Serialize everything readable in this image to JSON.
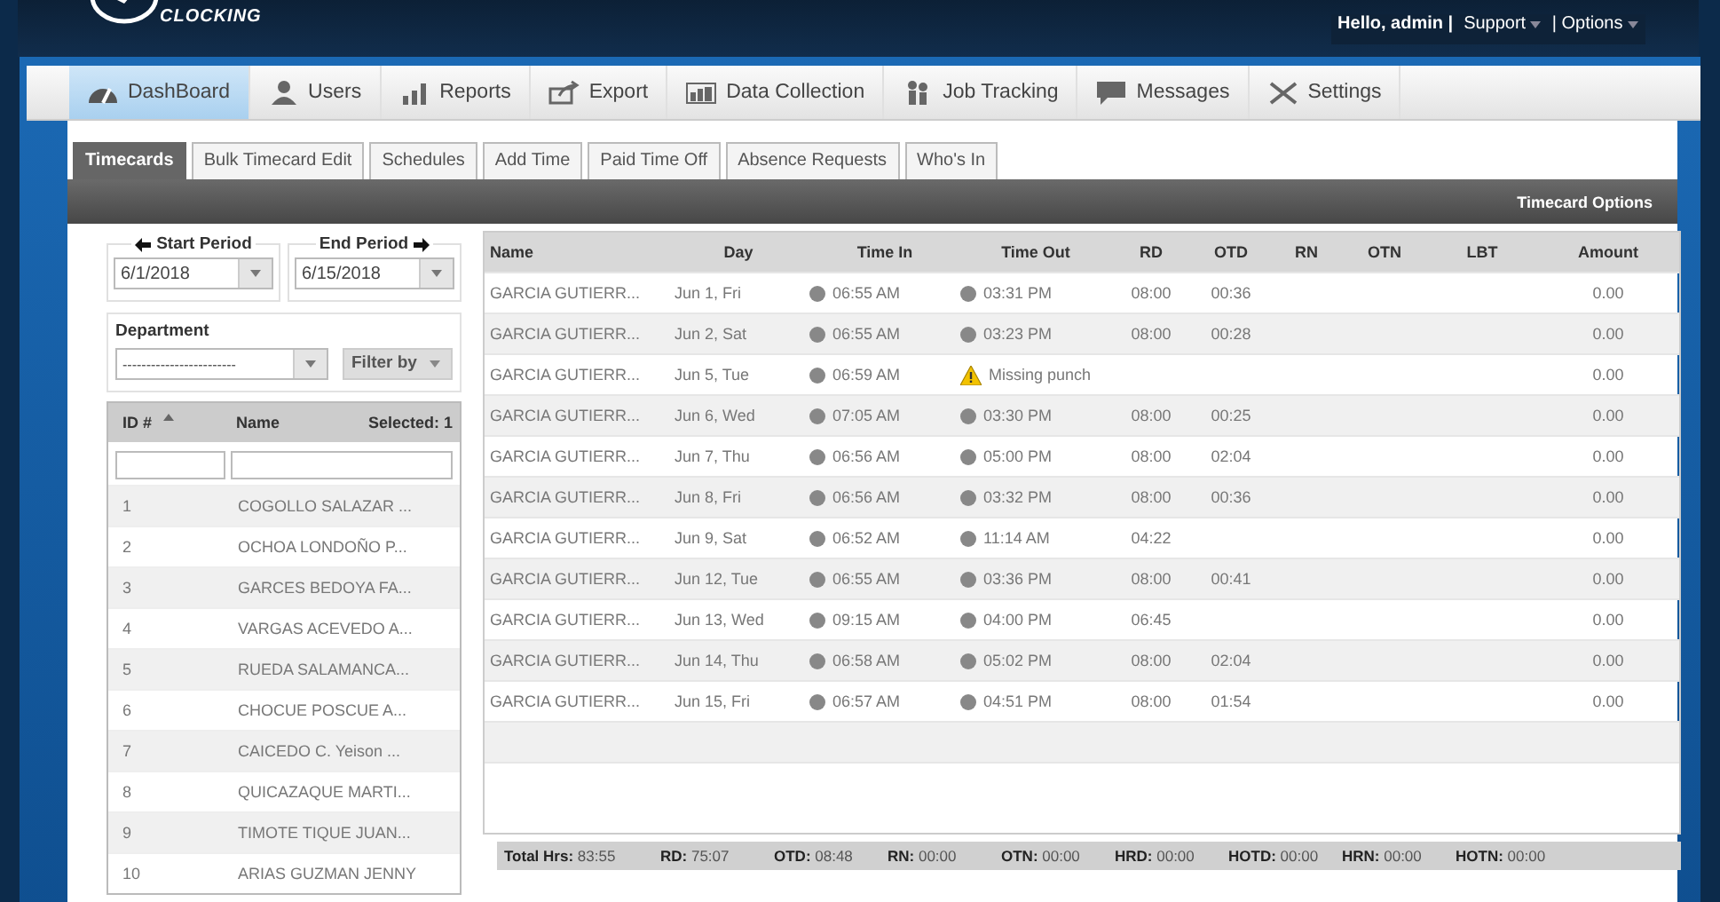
{
  "header": {
    "logo": "CLOCKING",
    "greeting": "Hello, admin |",
    "links": [
      {
        "label": "Support"
      },
      {
        "label": "| Options"
      }
    ]
  },
  "nav": [
    {
      "label": "DashBoard",
      "selected": true
    },
    {
      "label": "Users",
      "selected": false
    },
    {
      "label": "Reports",
      "selected": false
    },
    {
      "label": "Export",
      "selected": false
    },
    {
      "label": "Data Collection",
      "selected": false
    },
    {
      "label": "Job Tracking",
      "selected": false
    },
    {
      "label": "Messages",
      "selected": false
    },
    {
      "label": "Settings",
      "selected": false
    }
  ],
  "tabs": [
    {
      "label": "Timecards",
      "selected": true
    },
    {
      "label": "Bulk Timecard Edit",
      "selected": false
    },
    {
      "label": "Schedules",
      "selected": false
    },
    {
      "label": "Add Time",
      "selected": false
    },
    {
      "label": "Paid Time Off",
      "selected": false
    },
    {
      "label": "Absence Requests",
      "selected": false
    },
    {
      "label": "Who's In",
      "selected": false
    }
  ],
  "options_button": "Timecard Options",
  "period": {
    "start_label": "Start Period",
    "start_value": "6/1/2018",
    "end_label": "End Period",
    "end_value": "6/15/2018"
  },
  "department": {
    "label": "Department",
    "value": "------------------------",
    "filter": "Filter by"
  },
  "employees": {
    "columns": [
      "ID #",
      "Name",
      "Selected: 1"
    ],
    "rows": [
      {
        "id": "1",
        "name": "COGOLLO SALAZAR ..."
      },
      {
        "id": "2",
        "name": "OCHOA LONDOÑO P..."
      },
      {
        "id": "3",
        "name": "GARCES BEDOYA FA..."
      },
      {
        "id": "4",
        "name": "VARGAS ACEVEDO A..."
      },
      {
        "id": "5",
        "name": "RUEDA SALAMANCA..."
      },
      {
        "id": "6",
        "name": "CHOCUE POSCUE A..."
      },
      {
        "id": "7",
        "name": "CAICEDO C. Yeison ..."
      },
      {
        "id": "8",
        "name": "QUICAZAQUE MARTI..."
      },
      {
        "id": "9",
        "name": "TIMOTE TIQUE JUAN..."
      },
      {
        "id": "10",
        "name": "ARIAS GUZMAN JENNY"
      }
    ]
  },
  "timecards": {
    "columns": [
      "Name",
      "Day",
      "Time In",
      "Time Out",
      "RD",
      "OTD",
      "RN",
      "OTN",
      "LBT",
      "Amount"
    ],
    "rows": [
      {
        "name": "GARCIA GUTIERR...",
        "day": "Jun 1, Fri",
        "time_in": "06:55 AM",
        "time_out": {
          "kind": "punch",
          "text": "03:31 PM"
        },
        "rd": "08:00",
        "otd": "00:36",
        "amount": "0.00"
      },
      {
        "name": "GARCIA GUTIERR...",
        "day": "Jun 2, Sat",
        "time_in": "06:55 AM",
        "time_out": {
          "kind": "punch",
          "text": "03:23 PM"
        },
        "rd": "08:00",
        "otd": "00:28",
        "amount": "0.00"
      },
      {
        "name": "GARCIA GUTIERR...",
        "day": "Jun 5, Tue",
        "time_in": "06:59 AM",
        "time_out": {
          "kind": "warning",
          "text": "Missing punch"
        },
        "amount": "0.00"
      },
      {
        "name": "GARCIA GUTIERR...",
        "day": "Jun 6, Wed",
        "time_in": "07:05 AM",
        "time_out": {
          "kind": "punch",
          "text": "03:30 PM"
        },
        "rd": "08:00",
        "otd": "00:25",
        "amount": "0.00"
      },
      {
        "name": "GARCIA GUTIERR...",
        "day": "Jun 7, Thu",
        "time_in": "06:56 AM",
        "time_out": {
          "kind": "punch",
          "text": "05:00 PM"
        },
        "rd": "08:00",
        "otd": "02:04",
        "amount": "0.00"
      },
      {
        "name": "GARCIA GUTIERR...",
        "day": "Jun 8, Fri",
        "time_in": "06:56 AM",
        "time_out": {
          "kind": "punch",
          "text": "03:32 PM"
        },
        "rd": "08:00",
        "otd": "00:36",
        "amount": "0.00"
      },
      {
        "name": "GARCIA GUTIERR...",
        "day": "Jun 9, Sat",
        "time_in": "06:52 AM",
        "time_out": {
          "kind": "punch",
          "text": "11:14 AM"
        },
        "rd": "04:22",
        "amount": "0.00"
      },
      {
        "name": "GARCIA GUTIERR...",
        "day": "Jun 12, Tue",
        "time_in": "06:55 AM",
        "time_out": {
          "kind": "punch",
          "text": "03:36 PM"
        },
        "rd": "08:00",
        "otd": "00:41",
        "amount": "0.00"
      },
      {
        "name": "GARCIA GUTIERR...",
        "day": "Jun 13, Wed",
        "time_in": "09:15 AM",
        "time_out": {
          "kind": "punch",
          "text": "04:00 PM"
        },
        "rd": "06:45",
        "amount": "0.00"
      },
      {
        "name": "GARCIA GUTIERR...",
        "day": "Jun 14, Thu",
        "time_in": "06:58 AM",
        "time_out": {
          "kind": "punch",
          "text": "05:02 PM"
        },
        "rd": "08:00",
        "otd": "02:04",
        "amount": "0.00"
      },
      {
        "name": "GARCIA GUTIERR...",
        "day": "Jun 15, Fri",
        "time_in": "06:57 AM",
        "time_out": {
          "kind": "punch",
          "text": "04:51 PM"
        },
        "rd": "08:00",
        "otd": "01:54",
        "amount": "0.00"
      }
    ]
  },
  "totals": [
    {
      "label": "Total Hrs:",
      "value": "83:55"
    },
    {
      "label": "RD:",
      "value": "75:07"
    },
    {
      "label": "OTD:",
      "value": "08:48"
    },
    {
      "label": "RN:",
      "value": "00:00"
    },
    {
      "label": "OTN:",
      "value": "00:00"
    },
    {
      "label": "HRD:",
      "value": "00:00"
    },
    {
      "label": "HOTD:",
      "value": "00:00"
    },
    {
      "label": "HRN:",
      "value": "00:00"
    },
    {
      "label": "HOTN:",
      "value": "00:00"
    }
  ]
}
